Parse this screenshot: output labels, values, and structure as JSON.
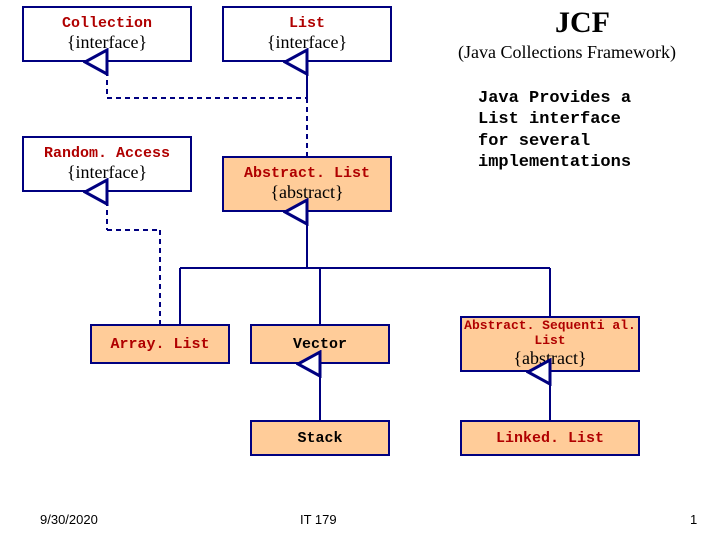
{
  "title": {
    "text": "JCF",
    "subtitle": "(Java Collections Framework)"
  },
  "description": "Java Provides a\nList interface\nfor several\nimplementations",
  "nodes": {
    "collection": {
      "name": "Collection",
      "stereo": "{interface}"
    },
    "list": {
      "name": "List",
      "stereo": "{interface}"
    },
    "randomaccess": {
      "name": "Random. Access",
      "stereo": "{interface}"
    },
    "abstractlist": {
      "name": "Abstract. List",
      "stereo": "{abstract}"
    },
    "arraylist": {
      "name": "Array. List"
    },
    "vector": {
      "name": "Vector"
    },
    "abstractseqlist": {
      "name": "Abstract. Sequenti al. List",
      "stereo": "{abstract}"
    },
    "stack": {
      "name": "Stack"
    },
    "linkedlist": {
      "name": "Linked. List"
    }
  },
  "footer": {
    "date": "9/30/2020",
    "course": "IT 179",
    "page": "1"
  },
  "chart_data": {
    "type": "table",
    "diagram_kind": "uml-class-hierarchy",
    "nodes": [
      {
        "id": "Collection",
        "stereotype": "interface"
      },
      {
        "id": "List",
        "stereotype": "interface"
      },
      {
        "id": "RandomAccess",
        "stereotype": "interface"
      },
      {
        "id": "AbstractList",
        "stereotype": "abstract"
      },
      {
        "id": "ArrayList"
      },
      {
        "id": "Vector"
      },
      {
        "id": "AbstractSequentialList",
        "stereotype": "abstract"
      },
      {
        "id": "Stack"
      },
      {
        "id": "LinkedList"
      }
    ],
    "edges": [
      {
        "from": "List",
        "to": "Collection",
        "kind": "extends",
        "dashed": true
      },
      {
        "from": "AbstractList",
        "to": "List",
        "kind": "implements",
        "dashed": true
      },
      {
        "from": "ArrayList",
        "to": "RandomAccess",
        "kind": "implements",
        "dashed": true
      },
      {
        "from": "ArrayList",
        "to": "AbstractList",
        "kind": "extends",
        "dashed": false
      },
      {
        "from": "Vector",
        "to": "AbstractList",
        "kind": "extends",
        "dashed": false
      },
      {
        "from": "AbstractSequentialList",
        "to": "AbstractList",
        "kind": "extends",
        "dashed": false
      },
      {
        "from": "Stack",
        "to": "Vector",
        "kind": "extends",
        "dashed": false
      },
      {
        "from": "LinkedList",
        "to": "AbstractSequentialList",
        "kind": "extends",
        "dashed": false
      }
    ]
  }
}
